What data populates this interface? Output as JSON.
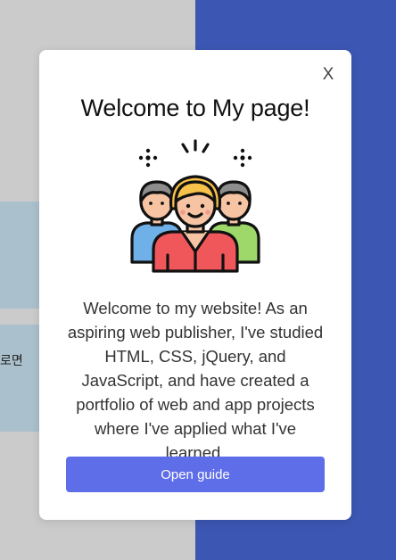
{
  "background": {
    "left_color": "#cbcbcb",
    "right_color": "#3c57b3",
    "card_color": "#aac0cd",
    "partial_text": "로면"
  },
  "modal": {
    "close_label": "X",
    "title": "Welcome to My page!",
    "illustration_icon": "team-people-icon",
    "body_text": "Welcome to my website! As an aspiring web publisher, I've studied HTML, CSS, jQuery, and JavaScript, and have created a portfolio of web and app projects where I've applied what I've learned.",
    "button_label": "Open guide",
    "button_color": "#5e6de8"
  }
}
